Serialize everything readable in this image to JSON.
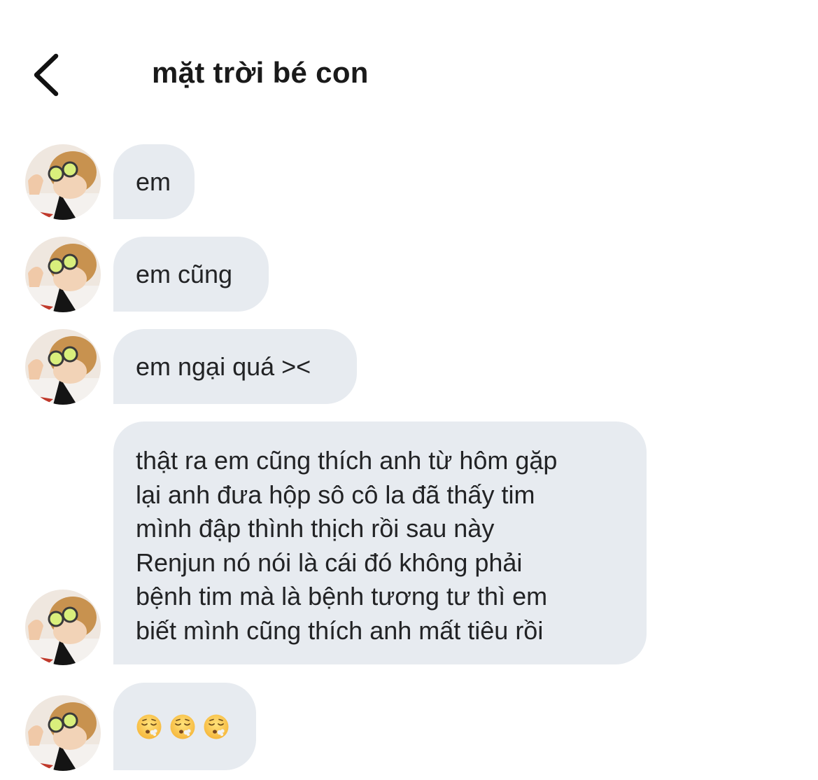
{
  "header": {
    "title": "mặt trời bé con",
    "back_icon": "chevron-left-icon"
  },
  "messages": [
    {
      "text": "em"
    },
    {
      "text": "em cũng"
    },
    {
      "text": "em ngại quá ><"
    },
    {
      "lines": [
        "thật ra em cũng thích anh từ hôm gặp",
        "lại anh đưa hộp sô cô la đã thấy tim",
        "mình đập thình thịch rồi sau này",
        "Renjun nó nói là cái đó không phải",
        "bệnh tim mà là bệnh tương tư thì em",
        "biết mình cũng thích anh mất tiêu rồi"
      ]
    },
    {
      "emoji": [
        "face-exhaling",
        "face-exhaling",
        "face-exhaling"
      ]
    }
  ],
  "colors": {
    "bubble_bg": "#e7ebf0",
    "text": "#222325",
    "background": "#ffffff"
  }
}
